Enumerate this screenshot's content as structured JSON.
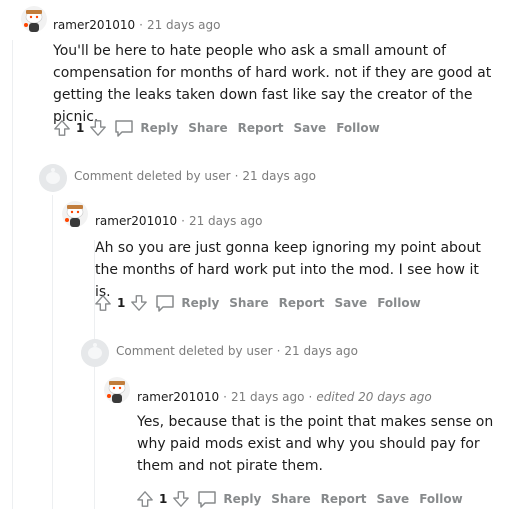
{
  "comments": [
    {
      "username": "ramer201010",
      "age": "21 days ago",
      "body": "You'll be here to hate people who ask a small amount of compensation for months of hard work. not if they are good at getting the leaks taken down fast like say the creator of the picnic.",
      "score": "1"
    },
    {
      "deleted_text": "Comment deleted by user",
      "age": "21 days ago"
    },
    {
      "username": "ramer201010",
      "age": "21 days ago",
      "body": "Ah so you are just gonna keep ignoring my point about the months of hard work put into the mod. I see how it is.",
      "score": "1"
    },
    {
      "deleted_text": "Comment deleted by user",
      "age": "21 days ago"
    },
    {
      "username": "ramer201010",
      "age": "21 days ago",
      "edited": "edited 20 days ago",
      "body": "Yes, because that is the point that makes sense on why paid mods exist and why you should pay for them and not pirate them.",
      "score": "1"
    }
  ],
  "actions": {
    "reply": "Reply",
    "share": "Share",
    "report": "Report",
    "save": "Save",
    "follow": "Follow"
  },
  "separator": "·",
  "icons": {
    "upvote": "upvote-arrow-icon",
    "downvote": "downvote-arrow-icon",
    "reply": "speech-bubble-icon",
    "avatar": "snoo-avatar",
    "deleted_avatar": "deleted-user-avatar"
  },
  "colors": {
    "text": "#1c1c1c",
    "meta": "#7c7c7c",
    "action": "#878a8c",
    "thread_line": "#edeff1"
  }
}
